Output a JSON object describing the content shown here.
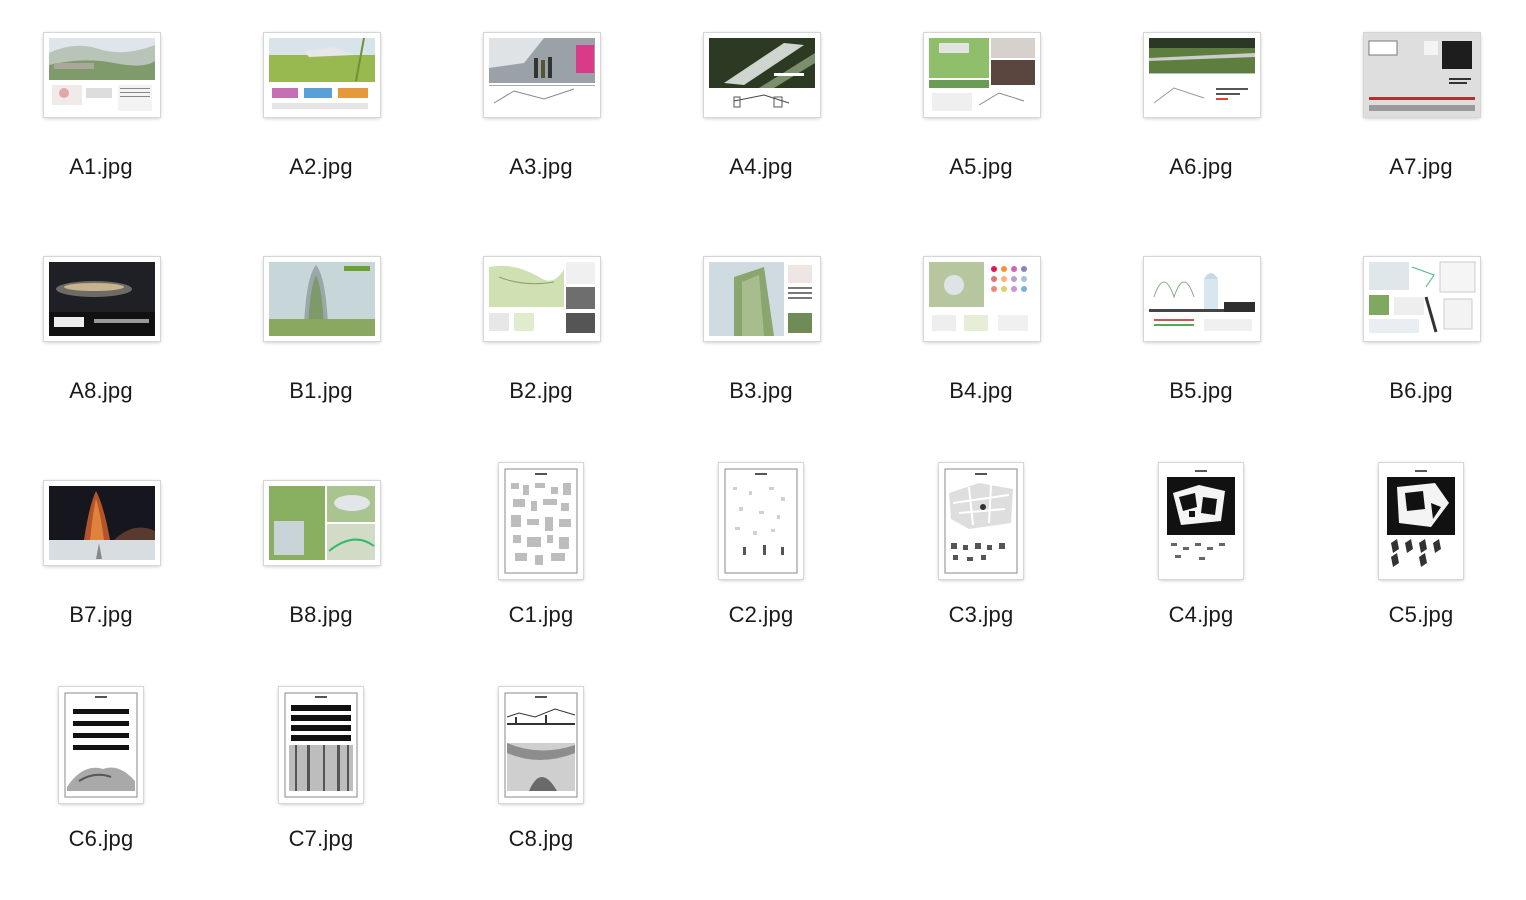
{
  "files": [
    {
      "name": "A1.jpg",
      "kind": "aerial-landscape"
    },
    {
      "name": "A2.jpg",
      "kind": "green-field"
    },
    {
      "name": "A3.jpg",
      "kind": "interior-people"
    },
    {
      "name": "A4.jpg",
      "kind": "dark-angular"
    },
    {
      "name": "A5.jpg",
      "kind": "green-collage"
    },
    {
      "name": "A6.jpg",
      "kind": "sky-bridge"
    },
    {
      "name": "A7.jpg",
      "kind": "grey-sheet"
    },
    {
      "name": "A8.jpg",
      "kind": "night-structure"
    },
    {
      "name": "B1.jpg",
      "kind": "tower-green"
    },
    {
      "name": "B2.jpg",
      "kind": "site-plan"
    },
    {
      "name": "B3.jpg",
      "kind": "green-facade"
    },
    {
      "name": "B4.jpg",
      "kind": "swatch-grid"
    },
    {
      "name": "B5.jpg",
      "kind": "section-diagram"
    },
    {
      "name": "B6.jpg",
      "kind": "diagram-collage"
    },
    {
      "name": "B7.jpg",
      "kind": "night-tower"
    },
    {
      "name": "B8.jpg",
      "kind": "green-collage-2"
    },
    {
      "name": "C1.jpg",
      "kind": "sketch-sheet"
    },
    {
      "name": "C2.jpg",
      "kind": "sparse-sheet"
    },
    {
      "name": "C3.jpg",
      "kind": "city-map"
    },
    {
      "name": "C4.jpg",
      "kind": "black-map"
    },
    {
      "name": "C5.jpg",
      "kind": "black-map-2"
    },
    {
      "name": "C6.jpg",
      "kind": "stripes-landscape"
    },
    {
      "name": "C7.jpg",
      "kind": "bars-forest"
    },
    {
      "name": "C8.jpg",
      "kind": "section-interior"
    }
  ]
}
